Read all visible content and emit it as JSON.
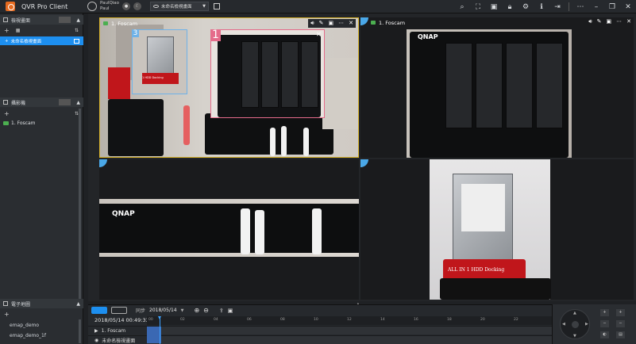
{
  "app": {
    "title": "QVR Pro Client",
    "user_name": "PaulQiao",
    "user_sub": "Paul",
    "live_label": "LIVE",
    "face_label": "Face"
  },
  "view_select": {
    "value": "未命名檢視畫面"
  },
  "sidebar": {
    "views_title": "檢視畫面",
    "view_items": [
      {
        "label": "未命名檢視畫面"
      }
    ],
    "cameras_title": "攝影機",
    "camera_items": [
      {
        "label": "1. Foscam"
      }
    ],
    "emap_title": "電子地圖",
    "emap_items": [
      {
        "label": "emap_demo"
      },
      {
        "label": "emap_demo_1f"
      }
    ]
  },
  "panes": [
    {
      "title": "1. Foscam",
      "pip_numbers": [
        "1",
        "3"
      ]
    },
    {
      "title": "1. Foscam"
    }
  ],
  "scene_text": {
    "qnap": "QNAP",
    "dock": "ALL IN 1 HDD Docking",
    "small_dock": "1 HDD Docking"
  },
  "playback": {
    "sync_label": "同步",
    "date": "2018/05/14",
    "timecode": "2018/05/14 00:49:33",
    "ticks": [
      "00",
      "02",
      "04",
      "06",
      "08",
      "10",
      "12",
      "14",
      "16",
      "18",
      "20",
      "22"
    ],
    "rows": [
      {
        "label": "1. Foscam"
      },
      {
        "label": "未命名檢視畫面"
      }
    ]
  },
  "colors": {
    "accent": "#1d8ff0",
    "selected_border": "#d8b32a",
    "recording": "#4caf50",
    "pip_pink": "#e56b8a",
    "pip_blue": "#6fb2e8",
    "timeline_fill": "#3a68b3"
  }
}
